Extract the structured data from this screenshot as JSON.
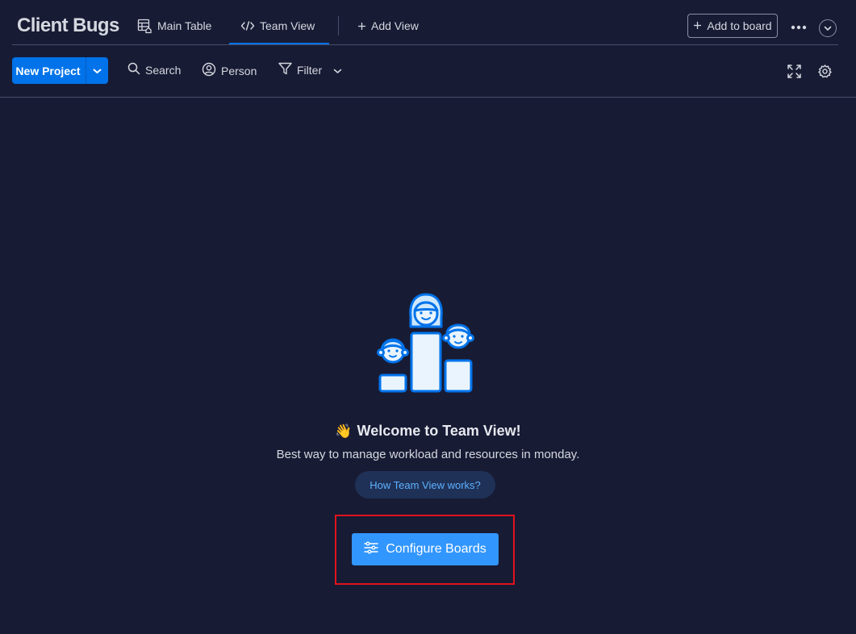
{
  "header": {
    "board_title": "Client Bugs",
    "tabs": [
      {
        "label": "Main Table",
        "icon": "table-home-icon"
      },
      {
        "label": "Team View",
        "icon": "code-icon",
        "active": true
      },
      {
        "label": "Add View",
        "icon": "plus-icon"
      }
    ],
    "add_to_board_label": "Add to board",
    "more_icon": "more-dots-icon",
    "collapse_icon": "chevron-down-icon"
  },
  "toolbar": {
    "new_project_label": "New Project",
    "search_label": "Search",
    "person_label": "Person",
    "filter_label": "Filter",
    "expand_icon": "expand-icon",
    "settings_icon": "gear-icon"
  },
  "empty_state": {
    "wave_emoji": "👋",
    "title": "Welcome to Team View!",
    "subtitle": "Best way to manage workload and resources in monday.",
    "how_link_label": "How Team View works?",
    "configure_label": "Configure Boards"
  },
  "colors": {
    "background": "#181b34",
    "primary": "#0073ea",
    "configure_button": "#3296ff",
    "highlight": "#e2131b",
    "link": "#5eb1ff"
  }
}
